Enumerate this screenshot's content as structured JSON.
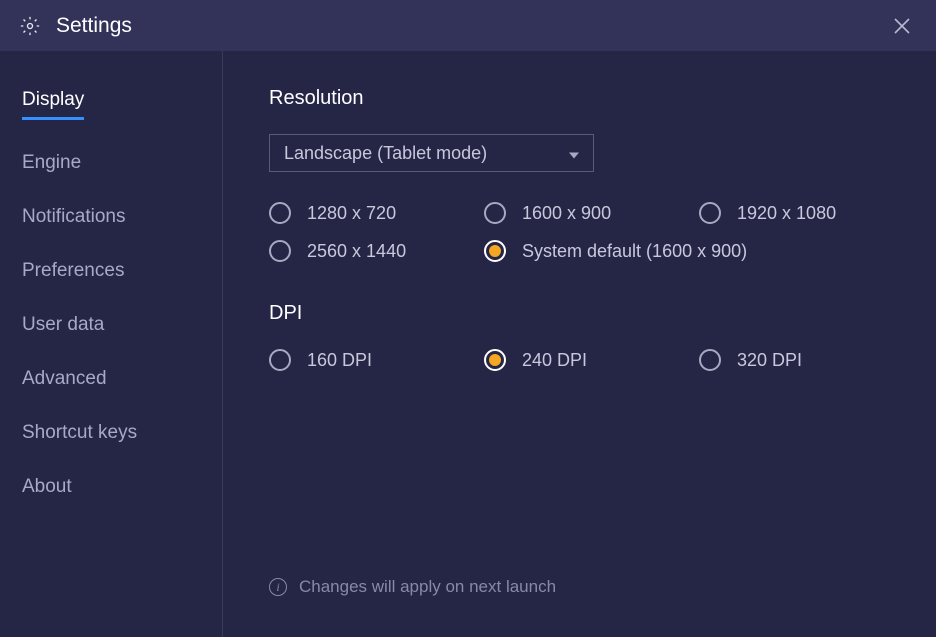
{
  "window": {
    "title": "Settings"
  },
  "sidebar": {
    "items": [
      {
        "label": "Display",
        "active": true
      },
      {
        "label": "Engine",
        "active": false
      },
      {
        "label": "Notifications",
        "active": false
      },
      {
        "label": "Preferences",
        "active": false
      },
      {
        "label": "User data",
        "active": false
      },
      {
        "label": "Advanced",
        "active": false
      },
      {
        "label": "Shortcut keys",
        "active": false
      },
      {
        "label": "About",
        "active": false
      }
    ]
  },
  "main": {
    "resolution_title": "Resolution",
    "orientation_select": "Landscape (Tablet mode)",
    "resolution_options": [
      {
        "label": "1280 x 720",
        "selected": false
      },
      {
        "label": "1600 x 900",
        "selected": false
      },
      {
        "label": "1920 x 1080",
        "selected": false
      },
      {
        "label": "2560 x 1440",
        "selected": false
      },
      {
        "label": "System default (1600 x 900)",
        "selected": true
      }
    ],
    "dpi_title": "DPI",
    "dpi_options": [
      {
        "label": "160 DPI",
        "selected": false
      },
      {
        "label": "240 DPI",
        "selected": true
      },
      {
        "label": "320 DPI",
        "selected": false
      }
    ],
    "info_text": "Changes will apply on next launch"
  }
}
